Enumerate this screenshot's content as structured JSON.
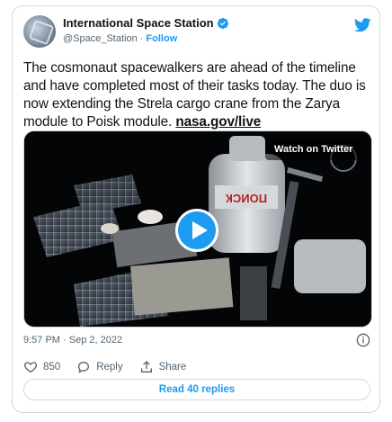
{
  "account": {
    "display_name": "International Space Station",
    "handle": "@Space_Station",
    "separator": "·",
    "follow_label": "Follow"
  },
  "tweet": {
    "text": "The cosmonaut spacewalkers are ahead of the timeline and have completed most of their tasks today. The duo is now extending the Strela cargo crane from the Zarya module to Poisk module. ",
    "link": "nasa.gov/live"
  },
  "media": {
    "watch_label": "Watch on Twitter",
    "module_text": "ПОИСК"
  },
  "meta": {
    "time": "9:57 PM · Sep 2, 2022"
  },
  "actions": {
    "like_count": "850",
    "reply_label": "Reply",
    "share_label": "Share"
  },
  "read_replies_label": "Read 40 replies",
  "colors": {
    "accent": "#1d9bf0",
    "text": "#0f1419",
    "muted": "#536471",
    "border": "#cfd9de"
  },
  "icons": [
    "verified-badge-icon",
    "twitter-bird-icon",
    "play-icon",
    "info-icon",
    "heart-icon",
    "reply-icon",
    "share-icon"
  ]
}
